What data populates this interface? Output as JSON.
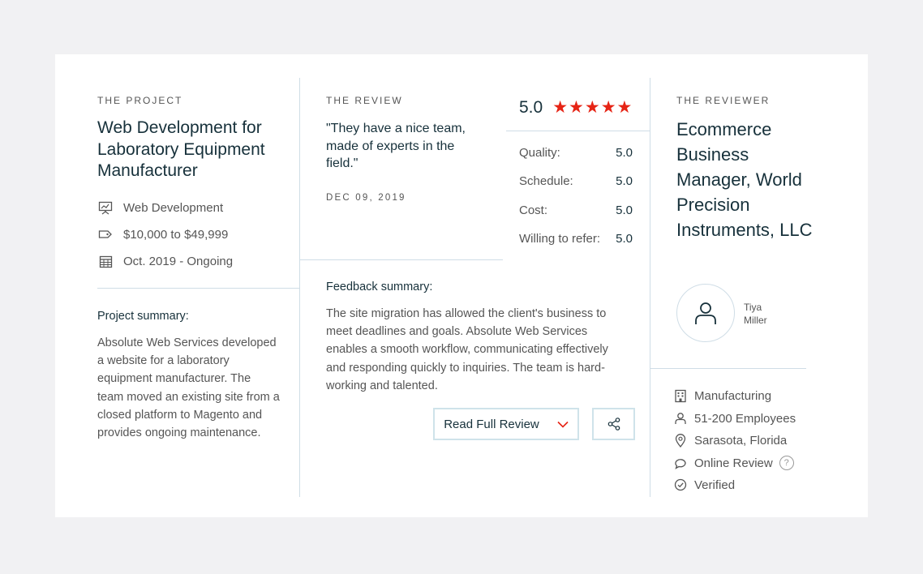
{
  "project": {
    "eyebrow": "THE PROJECT",
    "title": "Web Development for Laboratory Equipment Manufacturer",
    "meta": [
      {
        "icon": "presentation-icon",
        "text": "Web Development"
      },
      {
        "icon": "price-tag-icon",
        "text": "$10,000 to $49,999"
      },
      {
        "icon": "calendar-icon",
        "text": "Oct. 2019 - Ongoing"
      }
    ],
    "summary_heading": "Project summary:",
    "summary_text": "Absolute Web Services developed a website for a laboratory equipment manufacturer. The team moved an existing site from a closed platform to Magento and provides ongoing maintenance."
  },
  "review": {
    "eyebrow": "THE REVIEW",
    "quote": "\"They have a nice team, made of experts in the field.\"",
    "date": "DEC 09, 2019",
    "overall_score": "5.0",
    "stars": 5,
    "ratings": [
      {
        "label": "Quality:",
        "value": "5.0"
      },
      {
        "label": "Schedule:",
        "value": "5.0"
      },
      {
        "label": "Cost:",
        "value": "5.0"
      },
      {
        "label": "Willing to refer:",
        "value": "5.0"
      }
    ],
    "feedback_heading": "Feedback summary:",
    "feedback_text": "The site migration has allowed the client's business to meet deadlines and goals. Absolute Web Services enables a smooth workflow, communicating effectively and responding quickly to inquiries. The team is hard-working and talented.",
    "read_full_label": "Read Full Review"
  },
  "reviewer": {
    "eyebrow": "THE REVIEWER",
    "title": "Ecommerce Business Manager, World Precision Instruments, LLC",
    "name_first": "Tiya",
    "name_last": "Miller",
    "details": [
      {
        "icon": "building-icon",
        "text": "Manufacturing"
      },
      {
        "icon": "user-icon",
        "text": "51-200 Employees"
      },
      {
        "icon": "location-pin-icon",
        "text": "Sarasota, Florida"
      },
      {
        "icon": "chat-bubble-icon",
        "text": "Online Review"
      },
      {
        "icon": "check-circle-icon",
        "text": "Verified"
      }
    ],
    "help_symbol": "?"
  },
  "colors": {
    "star_red": "#e62415",
    "heading_navy": "#17313b",
    "divider_blue": "#cfdde6",
    "chevron_red": "#e62415"
  }
}
